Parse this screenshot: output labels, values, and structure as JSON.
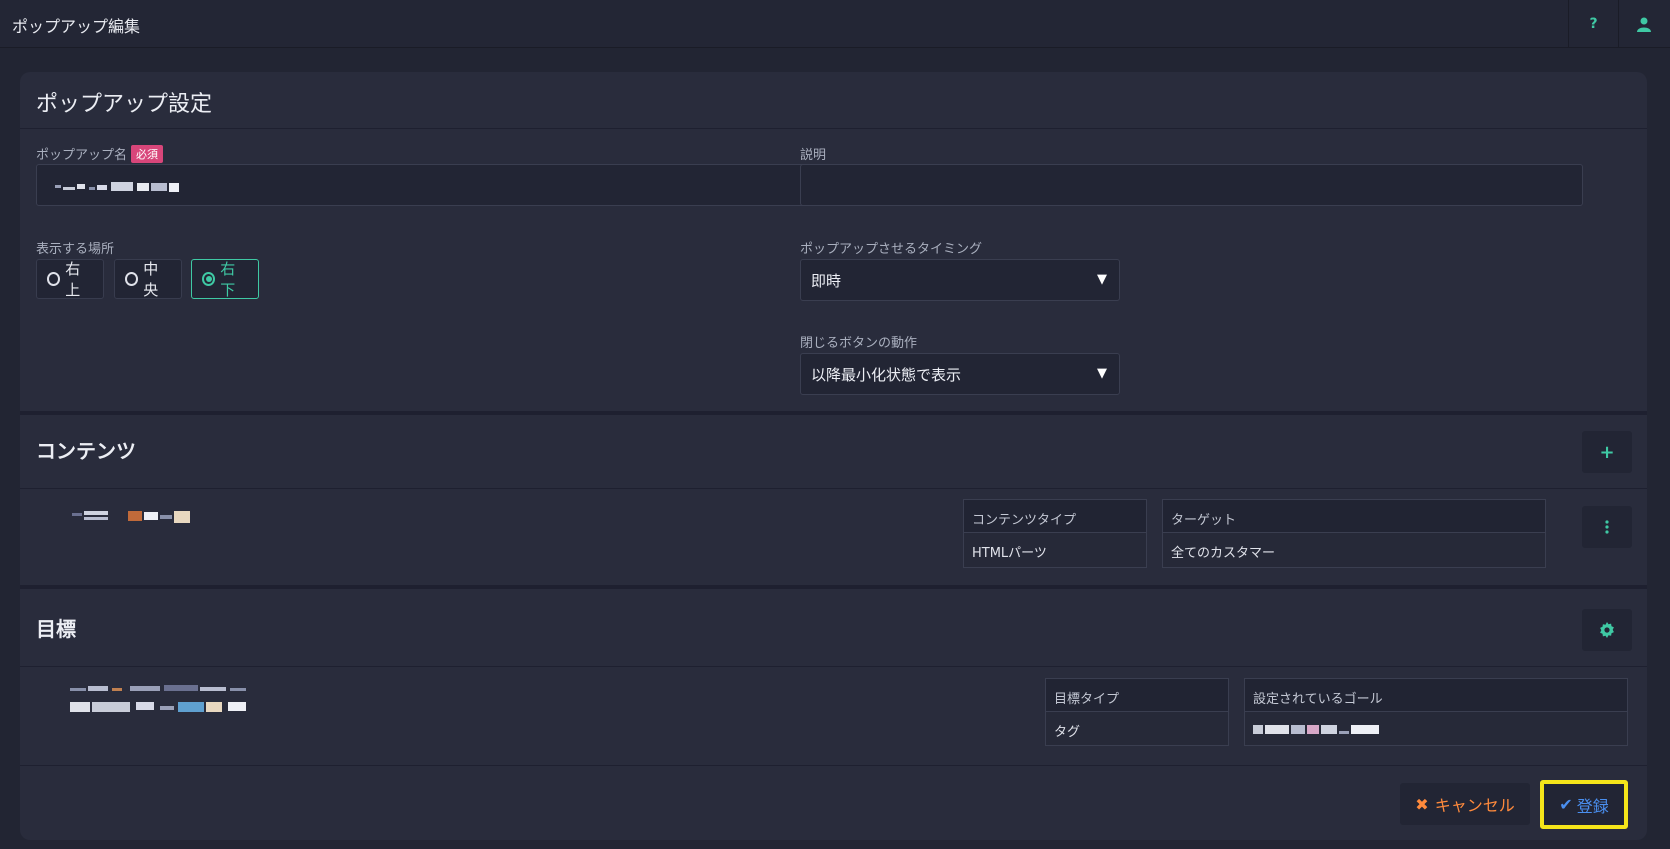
{
  "header": {
    "title": "ポップアップ編集",
    "help_icon": "question-icon",
    "user_icon": "user-icon"
  },
  "settings": {
    "title": "ポップアップ設定",
    "name_label": "ポップアップ名",
    "required_badge": "必須",
    "description_label": "説明",
    "description_value": "",
    "position_label": "表示する場所",
    "positions": [
      {
        "label": "右上",
        "selected": false
      },
      {
        "label": "中央",
        "selected": false
      },
      {
        "label": "右下",
        "selected": true
      }
    ],
    "timing_label": "ポップアップさせるタイミング",
    "timing_value": "即時",
    "close_label": "閉じるボタンの動作",
    "close_value": "以降最小化状態で表示"
  },
  "contents": {
    "title": "コンテンツ",
    "add_icon": "plus-icon",
    "menu_icon": "vertical-dots-icon",
    "type_header": "コンテンツタイプ",
    "type_value": "HTMLパーツ",
    "target_header": "ターゲット",
    "target_value": "全てのカスタマー"
  },
  "goal": {
    "title": "目標",
    "settings_icon": "gear-icon",
    "type_header": "目標タイプ",
    "type_value": "タグ",
    "goal_header": "設定されているゴール"
  },
  "footer": {
    "cancel_label": "キャンセル",
    "cancel_icon": "close-icon",
    "submit_label": "登録",
    "submit_icon": "check-icon",
    "cancel_color": "#ff8a3c",
    "submit_color": "#4a8ff0",
    "highlight_color": "#f5e51a"
  },
  "colors": {
    "accent": "#3fc9a4",
    "required": "#d8467a"
  }
}
